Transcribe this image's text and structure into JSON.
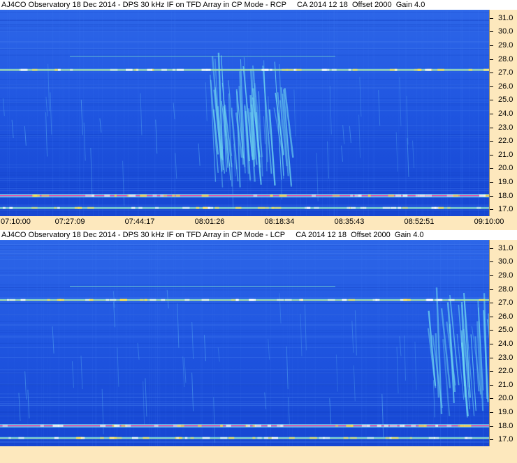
{
  "colors": {
    "background": "#fde8bd",
    "plot_base": "#1f55e0",
    "meteor": "#6fd7f0",
    "band_hot": "#ff3fa0",
    "band_warm": "#ffe14a"
  },
  "chart_data": [
    {
      "type": "heatmap",
      "title": "AJ4CO Observatory 18 Dec 2014 - DPS 30 kHz IF on TFD Array in CP Mode - RCP     CA 2014 12 18  Offset 2000  Gain 4.0",
      "xlabel": "",
      "ylabel": "",
      "x_ticks": [
        "07:10:00",
        "07:27:09",
        "07:44:17",
        "08:01:26",
        "08:18:34",
        "08:35:43",
        "08:52:51",
        "09:10:00"
      ],
      "y_ticks": [
        "31.0",
        "30.0",
        "29.0",
        "28.0",
        "27.0",
        "26.0",
        "25.0",
        "24.0",
        "23.0",
        "22.0",
        "21.0",
        "20.0",
        "19.0",
        "18.0",
        "17.0"
      ],
      "xlim": [
        "07:10:00",
        "09:10:00"
      ],
      "ylim": [
        16.5,
        31.6
      ],
      "emission_bands_mhz": [
        27.2,
        18.0,
        17.1
      ],
      "burst_window": [
        "08:00:00",
        "08:20:00"
      ]
    },
    {
      "type": "heatmap",
      "title": "AJ4CO Observatory 18 Dec 2014 - DPS 30 kHz IF on TFD Array in CP Mode - LCP     CA 2014 12 18  Offset 2000  Gain 4.0",
      "xlabel": "",
      "ylabel": "",
      "y_ticks": [
        "31.0",
        "30.0",
        "29.0",
        "28.0",
        "27.0",
        "26.0",
        "25.0",
        "24.0",
        "23.0",
        "22.0",
        "21.0",
        "20.0",
        "19.0",
        "18.0",
        "17.0"
      ],
      "xlim": [
        "07:10:00",
        "09:10:00"
      ],
      "ylim": [
        16.5,
        31.6
      ],
      "emission_bands_mhz": [
        27.2,
        18.0,
        17.1
      ],
      "burst_window": [
        "08:55:00",
        "09:10:00"
      ]
    }
  ]
}
